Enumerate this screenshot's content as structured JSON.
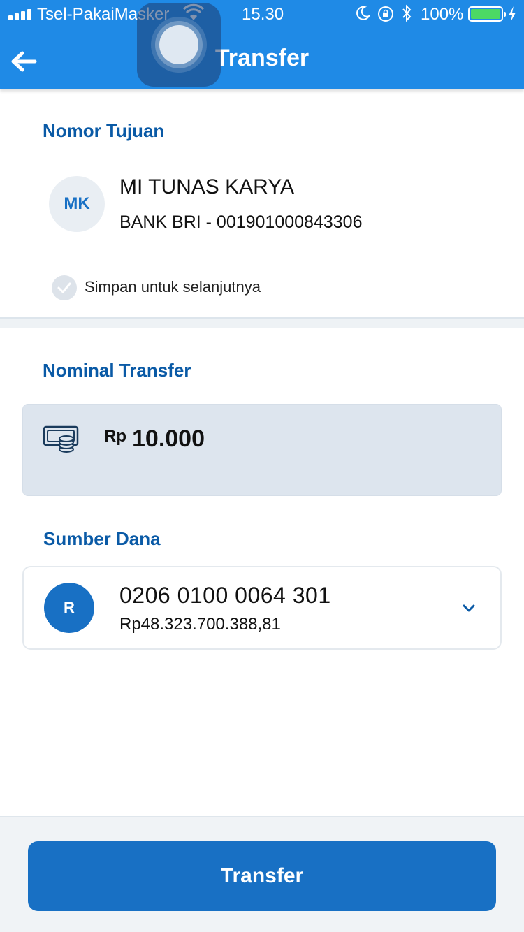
{
  "status_bar": {
    "carrier": "Tsel-PakaiMasker",
    "time": "15.30",
    "battery": "100%"
  },
  "nav": {
    "title": "Transfer",
    "back_icon": "arrow-left-icon"
  },
  "recipient": {
    "section_title": "Nomor Tujuan",
    "initials": "MK",
    "name": "MI TUNAS KARYA",
    "account": "BANK BRI - 001901000843306",
    "save_label": "Simpan untuk selanjutnya"
  },
  "amount": {
    "section_title": "Nominal Transfer",
    "currency": "Rp",
    "value": "10.000",
    "icon": "money-icon"
  },
  "source": {
    "section_title": "Sumber Dana",
    "initial": "R",
    "account_number": "0206 0100 0064 301",
    "balance": "Rp48.323.700.388,81",
    "icon": "chevron-down-icon"
  },
  "action": {
    "button_label": "Transfer"
  },
  "colors": {
    "primary": "#1f8ae6",
    "button": "#1870c4",
    "heading": "#0a5aa6"
  }
}
